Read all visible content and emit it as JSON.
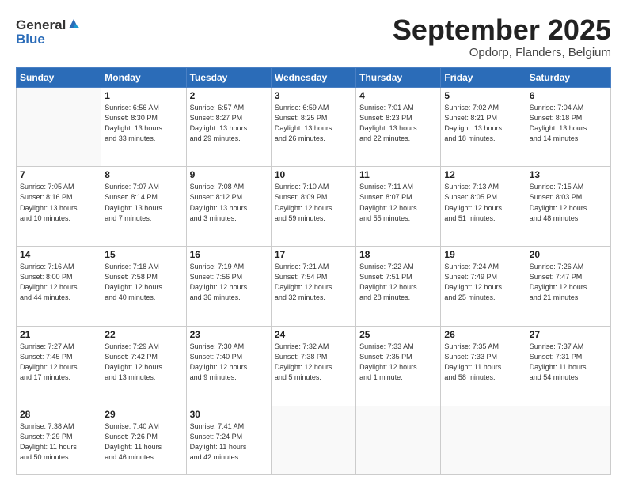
{
  "header": {
    "logo_line1": "General",
    "logo_line2": "Blue",
    "month": "September 2025",
    "location": "Opdorp, Flanders, Belgium"
  },
  "weekdays": [
    "Sunday",
    "Monday",
    "Tuesday",
    "Wednesday",
    "Thursday",
    "Friday",
    "Saturday"
  ],
  "weeks": [
    [
      {
        "day": "",
        "info": ""
      },
      {
        "day": "1",
        "info": "Sunrise: 6:56 AM\nSunset: 8:30 PM\nDaylight: 13 hours\nand 33 minutes."
      },
      {
        "day": "2",
        "info": "Sunrise: 6:57 AM\nSunset: 8:27 PM\nDaylight: 13 hours\nand 29 minutes."
      },
      {
        "day": "3",
        "info": "Sunrise: 6:59 AM\nSunset: 8:25 PM\nDaylight: 13 hours\nand 26 minutes."
      },
      {
        "day": "4",
        "info": "Sunrise: 7:01 AM\nSunset: 8:23 PM\nDaylight: 13 hours\nand 22 minutes."
      },
      {
        "day": "5",
        "info": "Sunrise: 7:02 AM\nSunset: 8:21 PM\nDaylight: 13 hours\nand 18 minutes."
      },
      {
        "day": "6",
        "info": "Sunrise: 7:04 AM\nSunset: 8:18 PM\nDaylight: 13 hours\nand 14 minutes."
      }
    ],
    [
      {
        "day": "7",
        "info": "Sunrise: 7:05 AM\nSunset: 8:16 PM\nDaylight: 13 hours\nand 10 minutes."
      },
      {
        "day": "8",
        "info": "Sunrise: 7:07 AM\nSunset: 8:14 PM\nDaylight: 13 hours\nand 7 minutes."
      },
      {
        "day": "9",
        "info": "Sunrise: 7:08 AM\nSunset: 8:12 PM\nDaylight: 13 hours\nand 3 minutes."
      },
      {
        "day": "10",
        "info": "Sunrise: 7:10 AM\nSunset: 8:09 PM\nDaylight: 12 hours\nand 59 minutes."
      },
      {
        "day": "11",
        "info": "Sunrise: 7:11 AM\nSunset: 8:07 PM\nDaylight: 12 hours\nand 55 minutes."
      },
      {
        "day": "12",
        "info": "Sunrise: 7:13 AM\nSunset: 8:05 PM\nDaylight: 12 hours\nand 51 minutes."
      },
      {
        "day": "13",
        "info": "Sunrise: 7:15 AM\nSunset: 8:03 PM\nDaylight: 12 hours\nand 48 minutes."
      }
    ],
    [
      {
        "day": "14",
        "info": "Sunrise: 7:16 AM\nSunset: 8:00 PM\nDaylight: 12 hours\nand 44 minutes."
      },
      {
        "day": "15",
        "info": "Sunrise: 7:18 AM\nSunset: 7:58 PM\nDaylight: 12 hours\nand 40 minutes."
      },
      {
        "day": "16",
        "info": "Sunrise: 7:19 AM\nSunset: 7:56 PM\nDaylight: 12 hours\nand 36 minutes."
      },
      {
        "day": "17",
        "info": "Sunrise: 7:21 AM\nSunset: 7:54 PM\nDaylight: 12 hours\nand 32 minutes."
      },
      {
        "day": "18",
        "info": "Sunrise: 7:22 AM\nSunset: 7:51 PM\nDaylight: 12 hours\nand 28 minutes."
      },
      {
        "day": "19",
        "info": "Sunrise: 7:24 AM\nSunset: 7:49 PM\nDaylight: 12 hours\nand 25 minutes."
      },
      {
        "day": "20",
        "info": "Sunrise: 7:26 AM\nSunset: 7:47 PM\nDaylight: 12 hours\nand 21 minutes."
      }
    ],
    [
      {
        "day": "21",
        "info": "Sunrise: 7:27 AM\nSunset: 7:45 PM\nDaylight: 12 hours\nand 17 minutes."
      },
      {
        "day": "22",
        "info": "Sunrise: 7:29 AM\nSunset: 7:42 PM\nDaylight: 12 hours\nand 13 minutes."
      },
      {
        "day": "23",
        "info": "Sunrise: 7:30 AM\nSunset: 7:40 PM\nDaylight: 12 hours\nand 9 minutes."
      },
      {
        "day": "24",
        "info": "Sunrise: 7:32 AM\nSunset: 7:38 PM\nDaylight: 12 hours\nand 5 minutes."
      },
      {
        "day": "25",
        "info": "Sunrise: 7:33 AM\nSunset: 7:35 PM\nDaylight: 12 hours\nand 1 minute."
      },
      {
        "day": "26",
        "info": "Sunrise: 7:35 AM\nSunset: 7:33 PM\nDaylight: 11 hours\nand 58 minutes."
      },
      {
        "day": "27",
        "info": "Sunrise: 7:37 AM\nSunset: 7:31 PM\nDaylight: 11 hours\nand 54 minutes."
      }
    ],
    [
      {
        "day": "28",
        "info": "Sunrise: 7:38 AM\nSunset: 7:29 PM\nDaylight: 11 hours\nand 50 minutes."
      },
      {
        "day": "29",
        "info": "Sunrise: 7:40 AM\nSunset: 7:26 PM\nDaylight: 11 hours\nand 46 minutes."
      },
      {
        "day": "30",
        "info": "Sunrise: 7:41 AM\nSunset: 7:24 PM\nDaylight: 11 hours\nand 42 minutes."
      },
      {
        "day": "",
        "info": ""
      },
      {
        "day": "",
        "info": ""
      },
      {
        "day": "",
        "info": ""
      },
      {
        "day": "",
        "info": ""
      }
    ]
  ]
}
